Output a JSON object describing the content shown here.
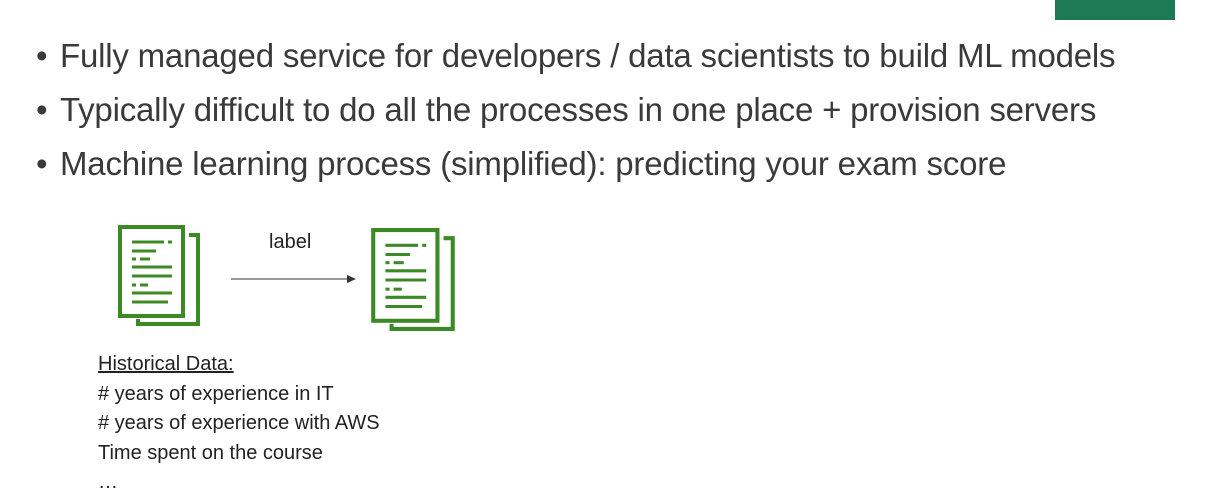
{
  "slide": {
    "bullets": [
      "Fully managed service for developers / data scientists to build ML models",
      "Typically difficult to do all the processes in one place + provision servers",
      "Machine learning process (simplified): predicting your exam score"
    ],
    "bullet_glyph": "•"
  },
  "diagram": {
    "source_icon": "document-icon",
    "target_icon": "document-icon",
    "arrow_label": "label",
    "icon_color": "#3b8a26"
  },
  "historical": {
    "title": "Historical Data:",
    "items": [
      "# years of experience in IT",
      "# years of experience with AWS",
      "Time spent on the course",
      "…"
    ]
  },
  "accent_color": "#1e7a54"
}
